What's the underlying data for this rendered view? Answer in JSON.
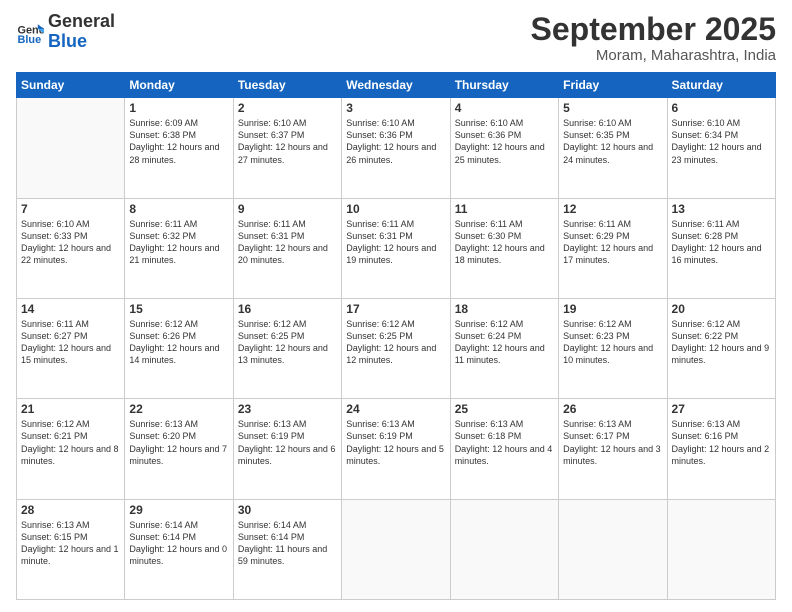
{
  "logo": {
    "general": "General",
    "blue": "Blue"
  },
  "header": {
    "month": "September 2025",
    "location": "Moram, Maharashtra, India"
  },
  "weekdays": [
    "Sunday",
    "Monday",
    "Tuesday",
    "Wednesday",
    "Thursday",
    "Friday",
    "Saturday"
  ],
  "weeks": [
    [
      {
        "day": null
      },
      {
        "day": 1,
        "sunrise": "6:09 AM",
        "sunset": "6:38 PM",
        "daylight": "12 hours and 28 minutes."
      },
      {
        "day": 2,
        "sunrise": "6:10 AM",
        "sunset": "6:37 PM",
        "daylight": "12 hours and 27 minutes."
      },
      {
        "day": 3,
        "sunrise": "6:10 AM",
        "sunset": "6:36 PM",
        "daylight": "12 hours and 26 minutes."
      },
      {
        "day": 4,
        "sunrise": "6:10 AM",
        "sunset": "6:36 PM",
        "daylight": "12 hours and 25 minutes."
      },
      {
        "day": 5,
        "sunrise": "6:10 AM",
        "sunset": "6:35 PM",
        "daylight": "12 hours and 24 minutes."
      },
      {
        "day": 6,
        "sunrise": "6:10 AM",
        "sunset": "6:34 PM",
        "daylight": "12 hours and 23 minutes."
      }
    ],
    [
      {
        "day": 7,
        "sunrise": "6:10 AM",
        "sunset": "6:33 PM",
        "daylight": "12 hours and 22 minutes."
      },
      {
        "day": 8,
        "sunrise": "6:11 AM",
        "sunset": "6:32 PM",
        "daylight": "12 hours and 21 minutes."
      },
      {
        "day": 9,
        "sunrise": "6:11 AM",
        "sunset": "6:31 PM",
        "daylight": "12 hours and 20 minutes."
      },
      {
        "day": 10,
        "sunrise": "6:11 AM",
        "sunset": "6:31 PM",
        "daylight": "12 hours and 19 minutes."
      },
      {
        "day": 11,
        "sunrise": "6:11 AM",
        "sunset": "6:30 PM",
        "daylight": "12 hours and 18 minutes."
      },
      {
        "day": 12,
        "sunrise": "6:11 AM",
        "sunset": "6:29 PM",
        "daylight": "12 hours and 17 minutes."
      },
      {
        "day": 13,
        "sunrise": "6:11 AM",
        "sunset": "6:28 PM",
        "daylight": "12 hours and 16 minutes."
      }
    ],
    [
      {
        "day": 14,
        "sunrise": "6:11 AM",
        "sunset": "6:27 PM",
        "daylight": "12 hours and 15 minutes."
      },
      {
        "day": 15,
        "sunrise": "6:12 AM",
        "sunset": "6:26 PM",
        "daylight": "12 hours and 14 minutes."
      },
      {
        "day": 16,
        "sunrise": "6:12 AM",
        "sunset": "6:25 PM",
        "daylight": "12 hours and 13 minutes."
      },
      {
        "day": 17,
        "sunrise": "6:12 AM",
        "sunset": "6:25 PM",
        "daylight": "12 hours and 12 minutes."
      },
      {
        "day": 18,
        "sunrise": "6:12 AM",
        "sunset": "6:24 PM",
        "daylight": "12 hours and 11 minutes."
      },
      {
        "day": 19,
        "sunrise": "6:12 AM",
        "sunset": "6:23 PM",
        "daylight": "12 hours and 10 minutes."
      },
      {
        "day": 20,
        "sunrise": "6:12 AM",
        "sunset": "6:22 PM",
        "daylight": "12 hours and 9 minutes."
      }
    ],
    [
      {
        "day": 21,
        "sunrise": "6:12 AM",
        "sunset": "6:21 PM",
        "daylight": "12 hours and 8 minutes."
      },
      {
        "day": 22,
        "sunrise": "6:13 AM",
        "sunset": "6:20 PM",
        "daylight": "12 hours and 7 minutes."
      },
      {
        "day": 23,
        "sunrise": "6:13 AM",
        "sunset": "6:19 PM",
        "daylight": "12 hours and 6 minutes."
      },
      {
        "day": 24,
        "sunrise": "6:13 AM",
        "sunset": "6:19 PM",
        "daylight": "12 hours and 5 minutes."
      },
      {
        "day": 25,
        "sunrise": "6:13 AM",
        "sunset": "6:18 PM",
        "daylight": "12 hours and 4 minutes."
      },
      {
        "day": 26,
        "sunrise": "6:13 AM",
        "sunset": "6:17 PM",
        "daylight": "12 hours and 3 minutes."
      },
      {
        "day": 27,
        "sunrise": "6:13 AM",
        "sunset": "6:16 PM",
        "daylight": "12 hours and 2 minutes."
      }
    ],
    [
      {
        "day": 28,
        "sunrise": "6:13 AM",
        "sunset": "6:15 PM",
        "daylight": "12 hours and 1 minute."
      },
      {
        "day": 29,
        "sunrise": "6:14 AM",
        "sunset": "6:14 PM",
        "daylight": "12 hours and 0 minutes."
      },
      {
        "day": 30,
        "sunrise": "6:14 AM",
        "sunset": "6:14 PM",
        "daylight": "11 hours and 59 minutes."
      },
      {
        "day": null
      },
      {
        "day": null
      },
      {
        "day": null
      },
      {
        "day": null
      }
    ]
  ]
}
